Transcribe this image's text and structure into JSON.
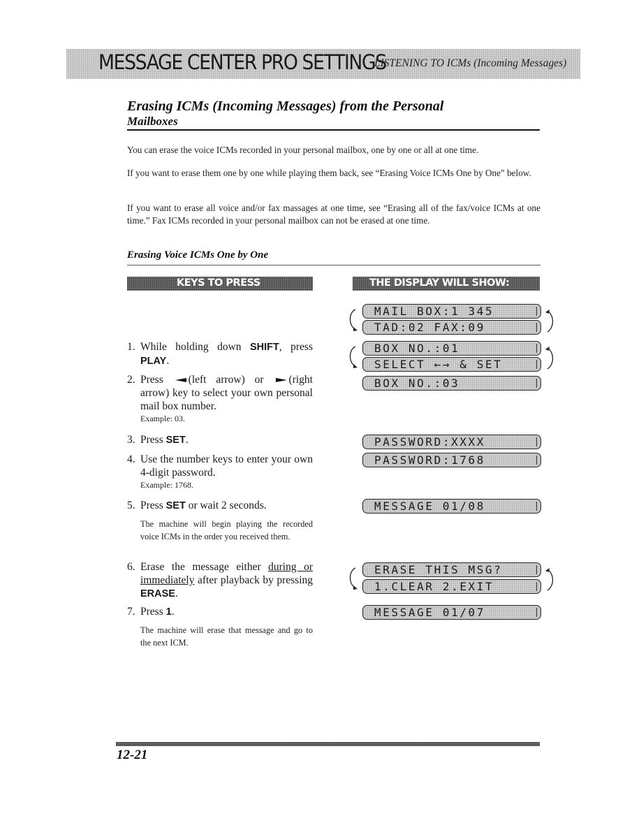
{
  "header": {
    "title": "MESSAGE CENTER PRO SETTINGS",
    "subtitle": "LISTENING TO ICMs (Incoming Messages)"
  },
  "section": {
    "title_line1": "Erasing ICMs (Incoming Messages) from the Personal",
    "title_line2": "Mailboxes",
    "paragraphs": [
      "You can erase the voice ICMs recorded in your personal mailbox, one by one or all at one time.",
      "If you want to erase them one by one while playing them back, see “Erasing Voice ICMs One by One” below.",
      "If you want to erase all voice and/or fax massages at one time, see “Erasing all of the fax/voice ICMs at one time.” Fax ICMs recorded in your personal mailbox can not be erased at one time."
    ]
  },
  "subsection": {
    "title": "Erasing Voice ICMs One by One",
    "keys_header": "KEYS TO PRESS",
    "display_header": "THE DISPLAY WILL SHOW:"
  },
  "steps": [
    {
      "num": "1.",
      "pre": "While holding down ",
      "key1": "SHIFT",
      "mid": ", press ",
      "key2": "PLAY",
      "post": "."
    },
    {
      "num": "2.",
      "pre": "Press ",
      "a1": "(left arrow) or ",
      "a2": "(right arrow) key to select your own personal mail box number.",
      "note": "Example: 03."
    },
    {
      "num": "3.",
      "pre": "Press ",
      "key": "SET",
      "post": "."
    },
    {
      "num": "4.",
      "text": "Use the number keys to enter your own 4-digit password.",
      "note": "Example: 1768."
    },
    {
      "num": "5.",
      "pre": "Press ",
      "key": "SET",
      "post": " or wait 2 seconds.",
      "desc": "The machine will begin playing the recorded voice ICMs in the order you received them."
    },
    {
      "num": "6.",
      "pre": "Erase the message either ",
      "u1": "during or immediately",
      "post": " after playback by pressing ",
      "key": "ERASE",
      "end": "."
    },
    {
      "num": "7.",
      "pre": "Press ",
      "key": "1",
      "post": ".",
      "desc": "The machine will erase that message and go to the next ICM."
    }
  ],
  "lcd": [
    "MAIL BOX:1 345",
    "TAD:02 FAX:09",
    "BOX NO.:01",
    "SELECT ←→ & SET",
    "BOX NO.:03",
    "PASSWORD:XXXX",
    "PASSWORD:1768",
    "MESSAGE 01/08",
    "ERASE THIS MSG?",
    "1.CLEAR 2.EXIT",
    "MESSAGE 01/07"
  ],
  "footer": {
    "page_number": "12-21"
  }
}
